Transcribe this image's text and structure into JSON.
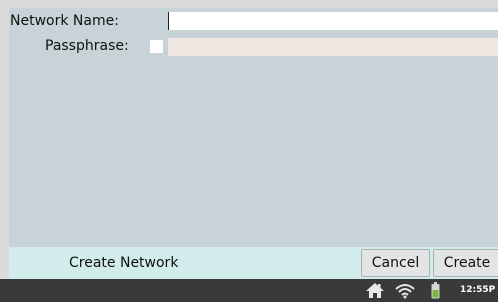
{
  "form": {
    "network_label": "Network Name:",
    "network_value": "",
    "passphrase_label": "Passphrase:",
    "passphrase_value": ""
  },
  "footer": {
    "title": "Create Network",
    "cancel_label": "Cancel",
    "create_label": "Create"
  },
  "taskbar": {
    "icons": [
      "home-icon",
      "wifi-icon",
      "battery-icon"
    ],
    "time": "12:55P"
  },
  "colors": {
    "window_bg": "#c8d3d8",
    "footer_bg": "#d2ecec",
    "taskbar_bg": "#3a3a3a",
    "passphrase_field_bg": "#f0e6e2"
  }
}
